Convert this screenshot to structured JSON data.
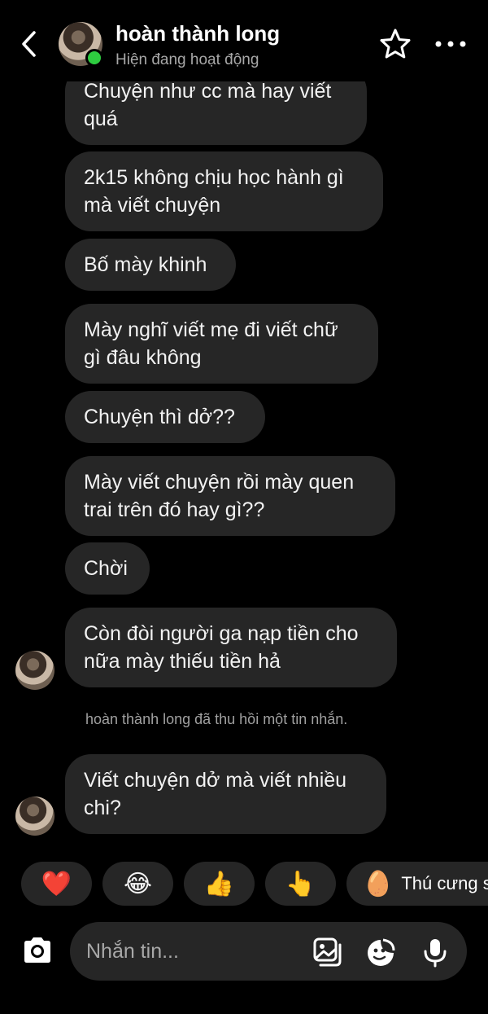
{
  "header": {
    "contact_name": "hoàn thành long",
    "status": "Hiện đang hoạt động"
  },
  "messages": [
    {
      "text_lines": [
        "Chuyện như cc mà hay viết",
        "quá"
      ]
    },
    {
      "text_lines": [
        "2k15 không chịu học hành gì",
        "mà viết chuyện"
      ]
    },
    {
      "text_lines": [
        "Bố mày khinh"
      ]
    },
    {
      "text_lines": [
        "Mày nghĩ viết mẹ đi viết chữ",
        "gì đâu không"
      ]
    },
    {
      "text_lines": [
        "Chuyện thì dở??"
      ]
    },
    {
      "text_lines": [
        "Mày viết chuyện rồi mày quen",
        "trai trên đó hay gì??"
      ]
    },
    {
      "text_lines": [
        "Chời"
      ]
    },
    {
      "text_lines": [
        "Còn đòi người ga nạp tiền cho",
        "nữa mày thiếu tiền hả"
      ]
    },
    {
      "text_lines": [
        "Viết chuyện dở mà viết nhiều",
        "chi?"
      ]
    }
  ],
  "system_message": "hoàn thành long đã thu hồi một tin nhắn.",
  "quick_replies": [
    {
      "emoji": "❤️",
      "icon": "heart-icon"
    },
    {
      "emoji": "😂",
      "icon": "laughing-icon"
    },
    {
      "emoji": "👍",
      "icon": "thumbs-up-icon"
    },
    {
      "emoji": "👆",
      "icon": "pointing-up-icon"
    },
    {
      "emoji": "🥚",
      "icon": "egg-icon",
      "label": "Thú cưng s"
    }
  ],
  "composer": {
    "placeholder": "Nhắn tin..."
  }
}
